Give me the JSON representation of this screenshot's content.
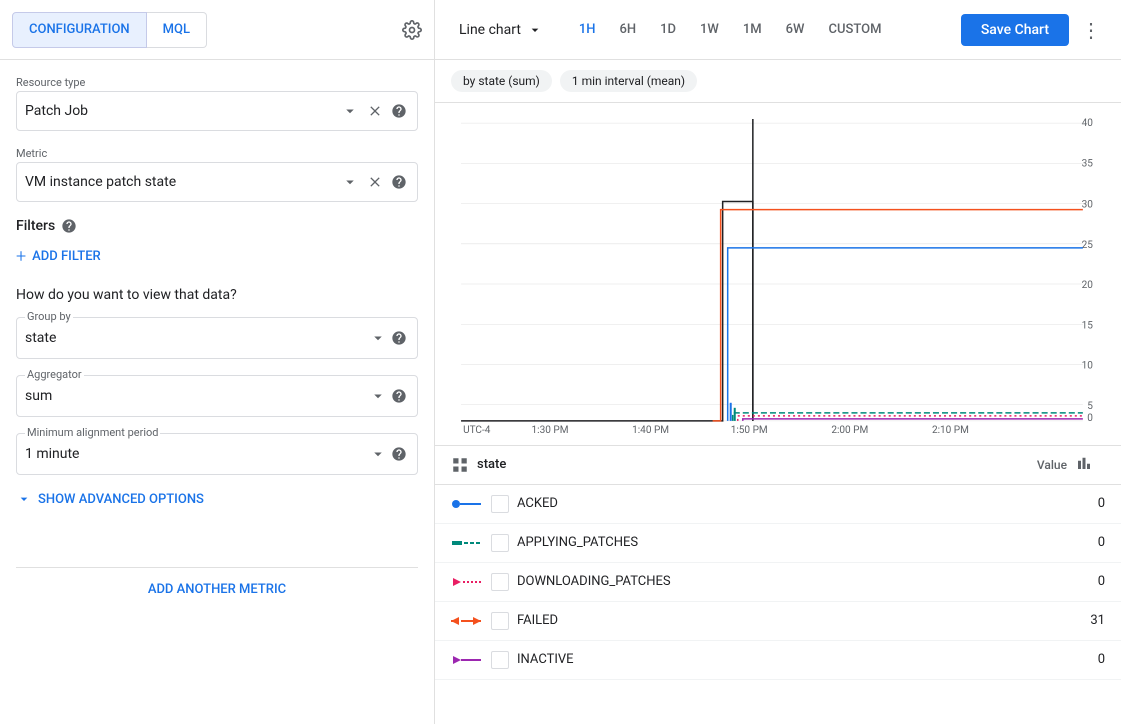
{
  "header": {
    "tabs": [
      {
        "id": "configuration",
        "label": "CONFIGURATION",
        "active": true
      },
      {
        "id": "mql",
        "label": "MQL",
        "active": false
      }
    ],
    "chart_type": "Line chart",
    "time_ranges": [
      {
        "id": "1h",
        "label": "1H",
        "active": true
      },
      {
        "id": "6h",
        "label": "6H",
        "active": false
      },
      {
        "id": "1d",
        "label": "1D",
        "active": false
      },
      {
        "id": "1w",
        "label": "1W",
        "active": false
      },
      {
        "id": "1m",
        "label": "1M",
        "active": false
      },
      {
        "id": "6w",
        "label": "6W",
        "active": false
      },
      {
        "id": "custom",
        "label": "CUSTOM",
        "active": false
      }
    ],
    "save_chart": "Save Chart"
  },
  "left_panel": {
    "resource_type_label": "Resource type",
    "resource_type_value": "Patch Job",
    "metric_label": "Metric",
    "metric_value": "VM instance patch state",
    "filters_label": "Filters",
    "add_filter_label": "ADD FILTER",
    "view_data_question": "How do you want to view that data?",
    "group_by_label": "Group by",
    "group_by_value": "state",
    "aggregator_label": "Aggregator",
    "aggregator_value": "sum",
    "min_alignment_label": "Minimum alignment period",
    "min_alignment_value": "1 minute",
    "show_advanced_label": "SHOW ADVANCED OPTIONS",
    "add_metric_label": "ADD ANOTHER METRIC"
  },
  "chart": {
    "filters": [
      "by state (sum)",
      "1 min interval (mean)"
    ],
    "y_axis": [
      40,
      35,
      30,
      25,
      20,
      15,
      10,
      5,
      0
    ],
    "x_axis": [
      "UTC-4",
      "1:30 PM",
      "1:40 PM",
      "1:50 PM",
      "2:00 PM",
      "2:10 PM"
    ],
    "legend_header": {
      "state_icon": "grid-icon",
      "state_label": "state",
      "value_label": "Value",
      "bars_icon": "bars-icon"
    },
    "legend_rows": [
      {
        "name": "ACKED",
        "value": "0",
        "color": "#1a73e8",
        "line_style": "solid"
      },
      {
        "name": "APPLYING_PATCHES",
        "value": "0",
        "color": "#00897b",
        "line_style": "dashed"
      },
      {
        "name": "DOWNLOADING_PATCHES",
        "value": "0",
        "color": "#e91e63",
        "line_style": "dotted"
      },
      {
        "name": "FAILED",
        "value": "31",
        "color": "#f4511e",
        "line_style": "solid"
      },
      {
        "name": "INACTIVE",
        "value": "0",
        "color": "#9c27b0",
        "line_style": "solid"
      }
    ]
  }
}
